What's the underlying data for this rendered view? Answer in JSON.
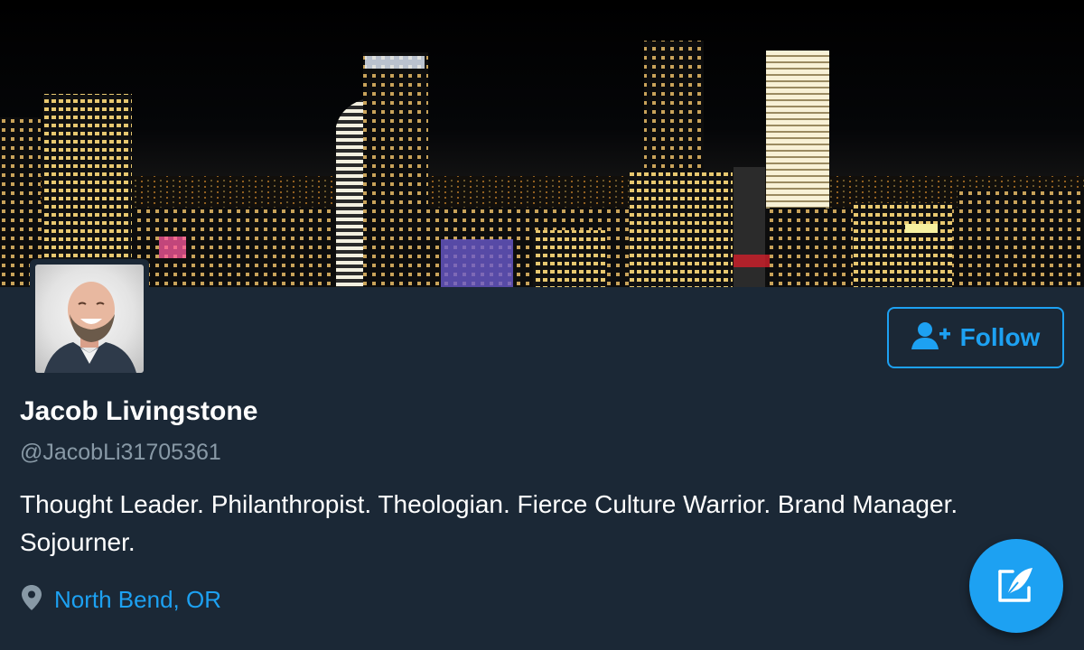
{
  "profile": {
    "display_name": "Jacob Livingstone",
    "handle": "@JacobLi31705361",
    "bio": "Thought Leader. Philanthropist. Theologian. Fierce Culture Warrior. Brand Manager. Sojourner.",
    "location": "North Bend, OR"
  },
  "actions": {
    "follow_label": "Follow",
    "follow_icon": "add-user-icon",
    "compose_icon": "compose-icon"
  },
  "banner": {
    "description_icon": "city-skyline-photo"
  },
  "icons": {
    "location": "map-pin-icon"
  },
  "colors": {
    "background": "#1b2836",
    "accent": "#1da1f2",
    "secondary_text": "#8899a6",
    "primary_text": "#ffffff"
  }
}
